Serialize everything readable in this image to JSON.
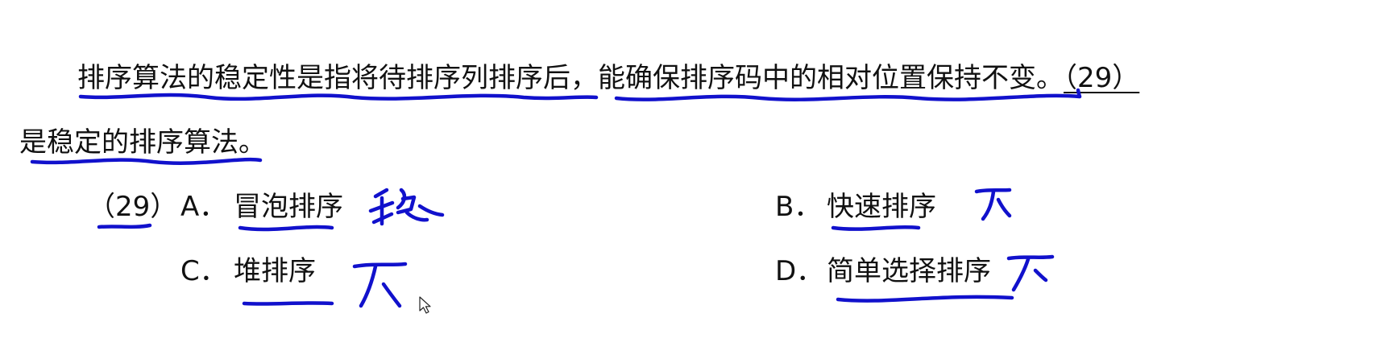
{
  "question": {
    "line1_prefix": "排序算法的稳定性是指将待排序列排序后，能确保排序码中的相对位置保持不变。",
    "blank_label": "（29）",
    "line2": "是稳定的排序算法。"
  },
  "options": {
    "number": "（29）",
    "a": {
      "letter": "A．",
      "text": "冒泡排序"
    },
    "b": {
      "letter": "B．",
      "text": "快速排序"
    },
    "c": {
      "letter": "C．",
      "text": "堆排序"
    },
    "d": {
      "letter": "D．",
      "text": "简单选择排序"
    }
  },
  "handwritten_notes": {
    "a": "稳",
    "b": "不",
    "c": "不",
    "d": "不"
  },
  "colors": {
    "ink": "#1111cc",
    "text": "#111111",
    "background": "#ffffff"
  }
}
